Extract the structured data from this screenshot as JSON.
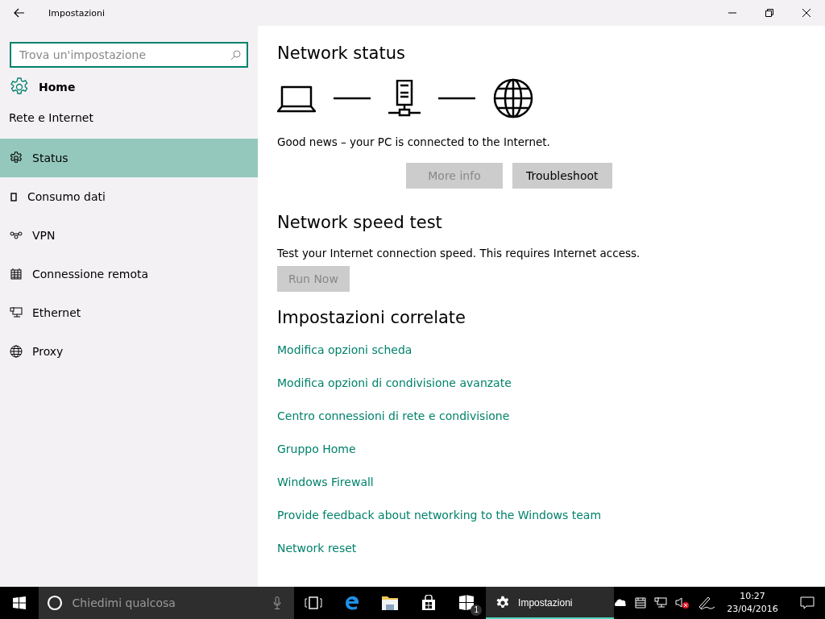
{
  "window": {
    "title": "Impostazioni"
  },
  "sidebar": {
    "search": {
      "placeholder": "Trova un'impostazione"
    },
    "home": "Home",
    "section": "Rete e Internet",
    "items": [
      {
        "label": "Status",
        "selected": true
      },
      {
        "label": "Consumo dati",
        "selected": false
      },
      {
        "label": "VPN",
        "selected": false
      },
      {
        "label": "Connessione remota",
        "selected": false
      },
      {
        "label": "Ethernet",
        "selected": false
      },
      {
        "label": "Proxy",
        "selected": false
      }
    ]
  },
  "network_status": {
    "heading": "Network status",
    "message": "Good news – your PC is connected to the Internet.",
    "buttons": [
      {
        "label": "More info",
        "disabled": true
      },
      {
        "label": "Troubleshoot",
        "disabled": false
      }
    ]
  },
  "speed_test": {
    "heading": "Network speed test",
    "description": "Test your Internet connection speed. This requires Internet access.",
    "button": {
      "label": "Run Now",
      "disabled": true
    }
  },
  "related": {
    "heading": "Impostazioni correlate",
    "links": [
      "Modifica opzioni scheda",
      "Modifica opzioni di condivisione avanzate",
      "Centro connessioni di rete e condivisione",
      "Gruppo Home",
      "Windows Firewall",
      "Provide feedback about networking to the Windows team",
      "Network reset"
    ]
  },
  "taskbar": {
    "search": {
      "placeholder": "Chiedimi qualcosa"
    },
    "apps": [
      {
        "kind": "taskview",
        "selected": false
      },
      {
        "kind": "edge",
        "selected": false
      },
      {
        "kind": "explorer",
        "selected": false
      },
      {
        "kind": "store",
        "selected": false
      },
      {
        "kind": "windows",
        "badge": "1",
        "selected": false
      },
      {
        "kind": "settings",
        "label": "Impostazioni",
        "selected": true
      }
    ],
    "clock": {
      "time": "10:27",
      "date": "23/04/2016"
    }
  }
}
